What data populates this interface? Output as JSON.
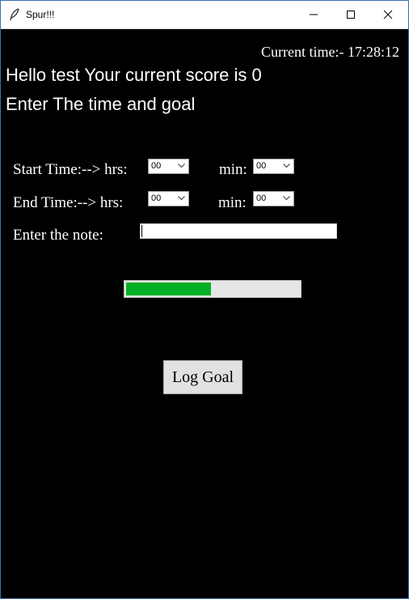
{
  "window": {
    "title": "Spur!!!"
  },
  "header": {
    "current_time": "Current time:- 17:28:12",
    "greeting": "Hello test Your current score is 0",
    "instruction": "Enter The time and goal"
  },
  "form": {
    "start_label": "Start Time:--> hrs:",
    "end_label": "End Time:--> hrs:",
    "min_label": "min:",
    "note_label": "Enter the note:",
    "start_hrs": "00",
    "start_min": "00",
    "end_hrs": "00",
    "end_min": "00",
    "note_value": ""
  },
  "progress": {
    "percent": 49,
    "fill_color": "#06b025"
  },
  "actions": {
    "log_goal": "Log Goal"
  }
}
